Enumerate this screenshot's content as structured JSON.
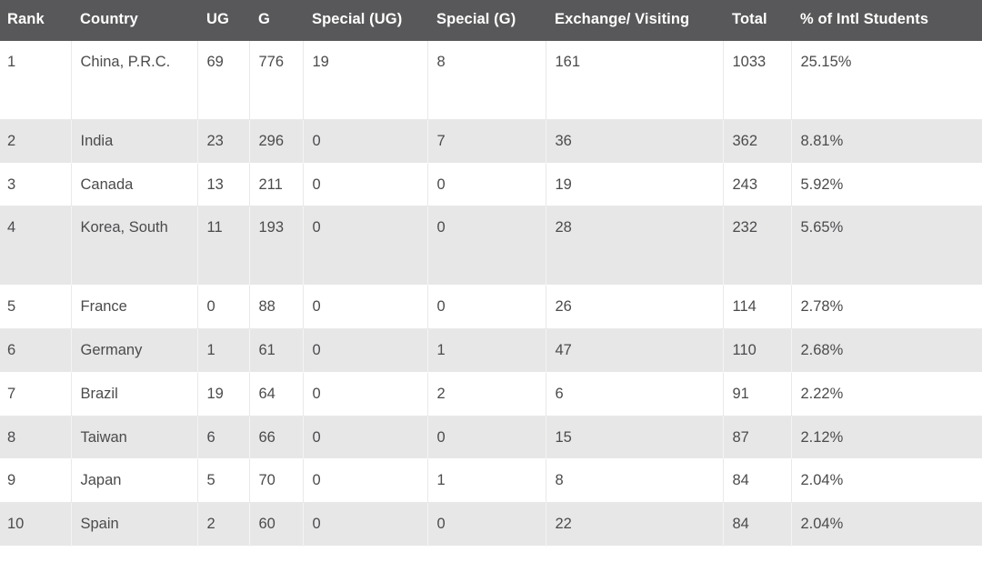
{
  "table": {
    "columns": [
      {
        "key": "rank",
        "label": "Rank",
        "class": "col-rank"
      },
      {
        "key": "country",
        "label": "Country",
        "class": "col-country"
      },
      {
        "key": "ug",
        "label": "UG",
        "class": "col-ug"
      },
      {
        "key": "g",
        "label": "G",
        "class": "col-g"
      },
      {
        "key": "sug",
        "label": "Special (UG)",
        "class": "col-sug"
      },
      {
        "key": "sg",
        "label": "Special (G)",
        "class": "col-sg"
      },
      {
        "key": "exchange",
        "label": "Exchange/ Visiting",
        "class": "col-exch"
      },
      {
        "key": "total",
        "label": "Total",
        "class": "col-total"
      },
      {
        "key": "pct",
        "label": "% of Intl Students",
        "class": "col-pct"
      }
    ],
    "rows": [
      {
        "rank": "1",
        "country": "China, P.R.C.",
        "ug": "69",
        "g": "776",
        "sug": "19",
        "sg": "8",
        "exchange": "161",
        "total": "1033",
        "pct": "25.15%",
        "tall": true
      },
      {
        "rank": "2",
        "country": "India",
        "ug": "23",
        "g": "296",
        "sug": "0",
        "sg": "7",
        "exchange": "36",
        "total": "362",
        "pct": "8.81%",
        "tall": false
      },
      {
        "rank": "3",
        "country": "Canada",
        "ug": "13",
        "g": "211",
        "sug": "0",
        "sg": "0",
        "exchange": "19",
        "total": "243",
        "pct": "5.92%",
        "tall": false
      },
      {
        "rank": "4",
        "country": "Korea, South",
        "ug": "11",
        "g": "193",
        "sug": "0",
        "sg": "0",
        "exchange": "28",
        "total": "232",
        "pct": "5.65%",
        "tall": true
      },
      {
        "rank": "5",
        "country": "France",
        "ug": "0",
        "g": "88",
        "sug": "0",
        "sg": "0",
        "exchange": "26",
        "total": "114",
        "pct": "2.78%",
        "tall": false
      },
      {
        "rank": "6",
        "country": "Germany",
        "ug": "1",
        "g": "61",
        "sug": "0",
        "sg": "1",
        "exchange": "47",
        "total": "110",
        "pct": "2.68%",
        "tall": false
      },
      {
        "rank": "7",
        "country": "Brazil",
        "ug": "19",
        "g": "64",
        "sug": "0",
        "sg": "2",
        "exchange": "6",
        "total": "91",
        "pct": "2.22%",
        "tall": false
      },
      {
        "rank": "8",
        "country": "Taiwan",
        "ug": "6",
        "g": "66",
        "sug": "0",
        "sg": "0",
        "exchange": "15",
        "total": "87",
        "pct": "2.12%",
        "tall": false
      },
      {
        "rank": "9",
        "country": "Japan",
        "ug": "5",
        "g": "70",
        "sug": "0",
        "sg": "1",
        "exchange": "8",
        "total": "84",
        "pct": "2.04%",
        "tall": false
      },
      {
        "rank": "10",
        "country": "Spain",
        "ug": "2",
        "g": "60",
        "sug": "0",
        "sg": "0",
        "exchange": "22",
        "total": "84",
        "pct": "2.04%",
        "tall": false
      }
    ]
  },
  "colors": {
    "header_background": "#58585a",
    "header_text": "#ffffff",
    "row_background_odd": "#ffffff",
    "row_background_even": "#e7e7e8",
    "body_text": "#4b4b4d"
  }
}
